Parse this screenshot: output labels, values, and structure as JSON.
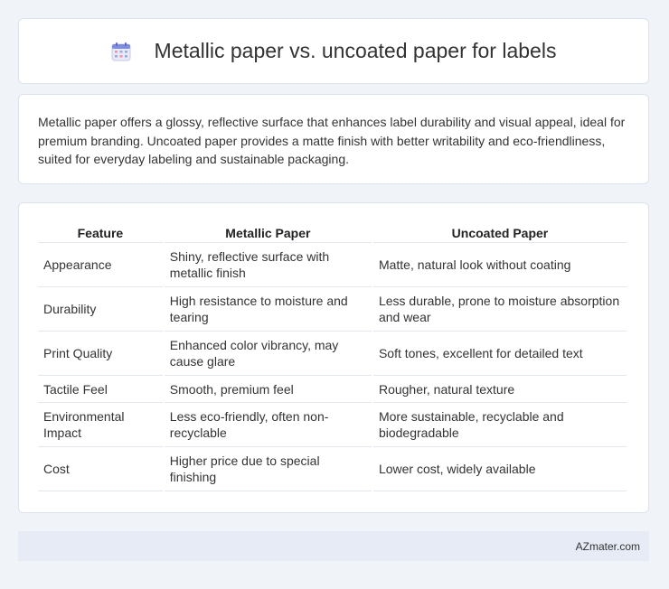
{
  "header": {
    "title": "Metallic paper vs. uncoated paper for labels",
    "icon": "calendar-icon"
  },
  "intro": "Metallic paper offers a glossy, reflective surface that enhances label durability and visual appeal, ideal for premium branding. Uncoated paper provides a matte finish with better writability and eco-friendliness, suited for everyday labeling and sustainable packaging.",
  "table": {
    "headers": [
      "Feature",
      "Metallic Paper",
      "Uncoated Paper"
    ],
    "rows": [
      [
        "Appearance",
        "Shiny, reflective surface with metallic finish",
        "Matte, natural look without coating"
      ],
      [
        "Durability",
        "High resistance to moisture and tearing",
        "Less durable, prone to moisture absorption and wear"
      ],
      [
        "Print Quality",
        "Enhanced color vibrancy, may cause glare",
        "Soft tones, excellent for detailed text"
      ],
      [
        "Tactile Feel",
        "Smooth, premium feel",
        "Rougher, natural texture"
      ],
      [
        "Environmental Impact",
        "Less eco-friendly, often non-recyclable",
        "More sustainable, recyclable and biodegradable"
      ],
      [
        "Cost",
        "Higher price due to special finishing",
        "Lower cost, widely available"
      ]
    ]
  },
  "footer": {
    "brand": "AZmater.com"
  }
}
